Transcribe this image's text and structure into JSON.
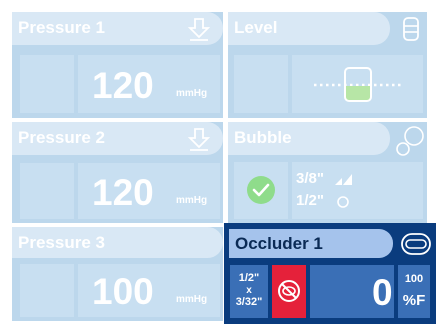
{
  "panels": {
    "pressure1": {
      "title": "Pressure 1",
      "value": "120",
      "unit": "mmHg",
      "icon": "down-arrow-icon"
    },
    "level": {
      "title": "Level",
      "icon": "level-container-icon",
      "indicator": "level-indicator-icon"
    },
    "pressure2": {
      "title": "Pressure 2",
      "value": "120",
      "unit": "mmHg",
      "icon": "down-arrow-icon"
    },
    "bubble": {
      "title": "Bubble",
      "icon": "bubbles-icon",
      "status": "check-icon",
      "size_top": "3/8\"",
      "size_bottom": "1/2\""
    },
    "pressure3": {
      "title": "Pressure 3",
      "value": "100",
      "unit": "mmHg"
    },
    "occluder1": {
      "title": "Occluder 1",
      "icon": "occluder-icon",
      "tube_top": "1/2\"",
      "tube_mid": "x",
      "tube_bottom": "3/32\"",
      "alarm_icon": "occlusion-alert-icon",
      "value": "0",
      "limit": "100",
      "limit_unit": "%F"
    }
  },
  "colors": {
    "panel": "#bcd7ec",
    "header_light": "#d9e8f5",
    "active_bg": "#0a3c7e",
    "active_header": "#a5c3ec",
    "active_box": "#3a6fb6",
    "alarm": "#e5213a",
    "ok": "#8fdc8b"
  }
}
